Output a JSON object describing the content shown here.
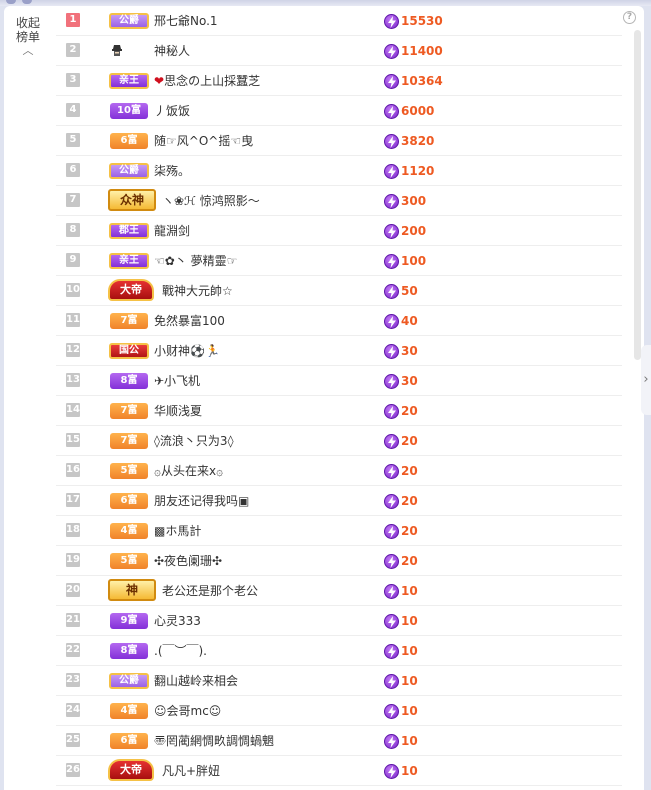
{
  "panel": {
    "collapse_label_line1": "收起",
    "collapse_label_line2": "榜单",
    "help_symbol": "?"
  },
  "colors": {
    "score": "#ee5a22",
    "rank_first": "#f1717b",
    "rank_default": "#c6c6c6"
  },
  "rows": [
    {
      "rank": "1",
      "badge": "公爵",
      "badge_style": "lilac",
      "name": "邢七爺No.1",
      "score": "15530"
    },
    {
      "rank": "2",
      "badge": "",
      "badge_style": "mystery",
      "name": "神秘人",
      "score": "11400"
    },
    {
      "rank": "3",
      "badge": "亲王",
      "badge_style": "purple-gold",
      "name": "思念の上山採蠶芝",
      "score": "10364",
      "heart": "❤"
    },
    {
      "rank": "4",
      "badge": "10富",
      "badge_style": "purple",
      "name": "丿饭饭",
      "score": "6000"
    },
    {
      "rank": "5",
      "badge": "6富",
      "badge_style": "orange",
      "name": "随☞风^O^摇☜曳",
      "score": "3820"
    },
    {
      "rank": "6",
      "badge": "公爵",
      "badge_style": "lilac",
      "name": "柒殇。",
      "score": "1120"
    },
    {
      "rank": "7",
      "badge": "众神",
      "badge_style": "god",
      "name": "ヽ❀ℋ 惊鸿照影～",
      "score": "300"
    },
    {
      "rank": "8",
      "badge": "郡王",
      "badge_style": "purple-gold",
      "name": "龍淵剑",
      "score": "200"
    },
    {
      "rank": "9",
      "badge": "亲王",
      "badge_style": "purple-gold",
      "name": "☜✿丶 夢精靈☞",
      "score": "100"
    },
    {
      "rank": "10",
      "badge": "大帝",
      "badge_style": "king",
      "name": "戰神大元帥☆",
      "score": "50"
    },
    {
      "rank": "11",
      "badge": "7富",
      "badge_style": "orange",
      "name": "免然暴富100",
      "score": "40"
    },
    {
      "rank": "12",
      "badge": "国公",
      "badge_style": "red",
      "name": "小财神⚽🏃",
      "score": "30"
    },
    {
      "rank": "13",
      "badge": "8富",
      "badge_style": "purple",
      "name": "✈小飞机",
      "score": "30"
    },
    {
      "rank": "14",
      "badge": "7富",
      "badge_style": "orange",
      "name": "华顺浅夏",
      "score": "20"
    },
    {
      "rank": "15",
      "badge": "7富",
      "badge_style": "orange",
      "name": "◊流浪丶只为3◊",
      "score": "20"
    },
    {
      "rank": "16",
      "badge": "5富",
      "badge_style": "orange",
      "name": "۞从头在来x۞",
      "score": "20"
    },
    {
      "rank": "17",
      "badge": "6富",
      "badge_style": "orange",
      "name": "朋友还记得我吗▣",
      "score": "20"
    },
    {
      "rank": "18",
      "badge": "4富",
      "badge_style": "orange",
      "name": "▩ホ馬計",
      "score": "20"
    },
    {
      "rank": "19",
      "badge": "5富",
      "badge_style": "orange",
      "name": "✣夜色阑珊✣",
      "score": "20"
    },
    {
      "rank": "20",
      "badge": "神",
      "badge_style": "god",
      "name": "老公还是那个老公",
      "score": "10"
    },
    {
      "rank": "21",
      "badge": "9富",
      "badge_style": "purple",
      "name": "心灵333",
      "score": "10"
    },
    {
      "rank": "22",
      "badge": "8富",
      "badge_style": "purple",
      "name": ".(￣︶￣).",
      "score": "10"
    },
    {
      "rank": "23",
      "badge": "公爵",
      "badge_style": "lilac",
      "name": "翻山越岭来相会",
      "score": "10"
    },
    {
      "rank": "24",
      "badge": "4富",
      "badge_style": "orange",
      "name": "☺会哥mc☺",
      "score": "10"
    },
    {
      "rank": "25",
      "badge": "6富",
      "badge_style": "orange",
      "name": "〠罔蔺網惆畂調惆蝸魍",
      "score": "10"
    },
    {
      "rank": "26",
      "badge": "大帝",
      "badge_style": "king",
      "name": "凡凡+胖妞",
      "score": "10"
    }
  ]
}
